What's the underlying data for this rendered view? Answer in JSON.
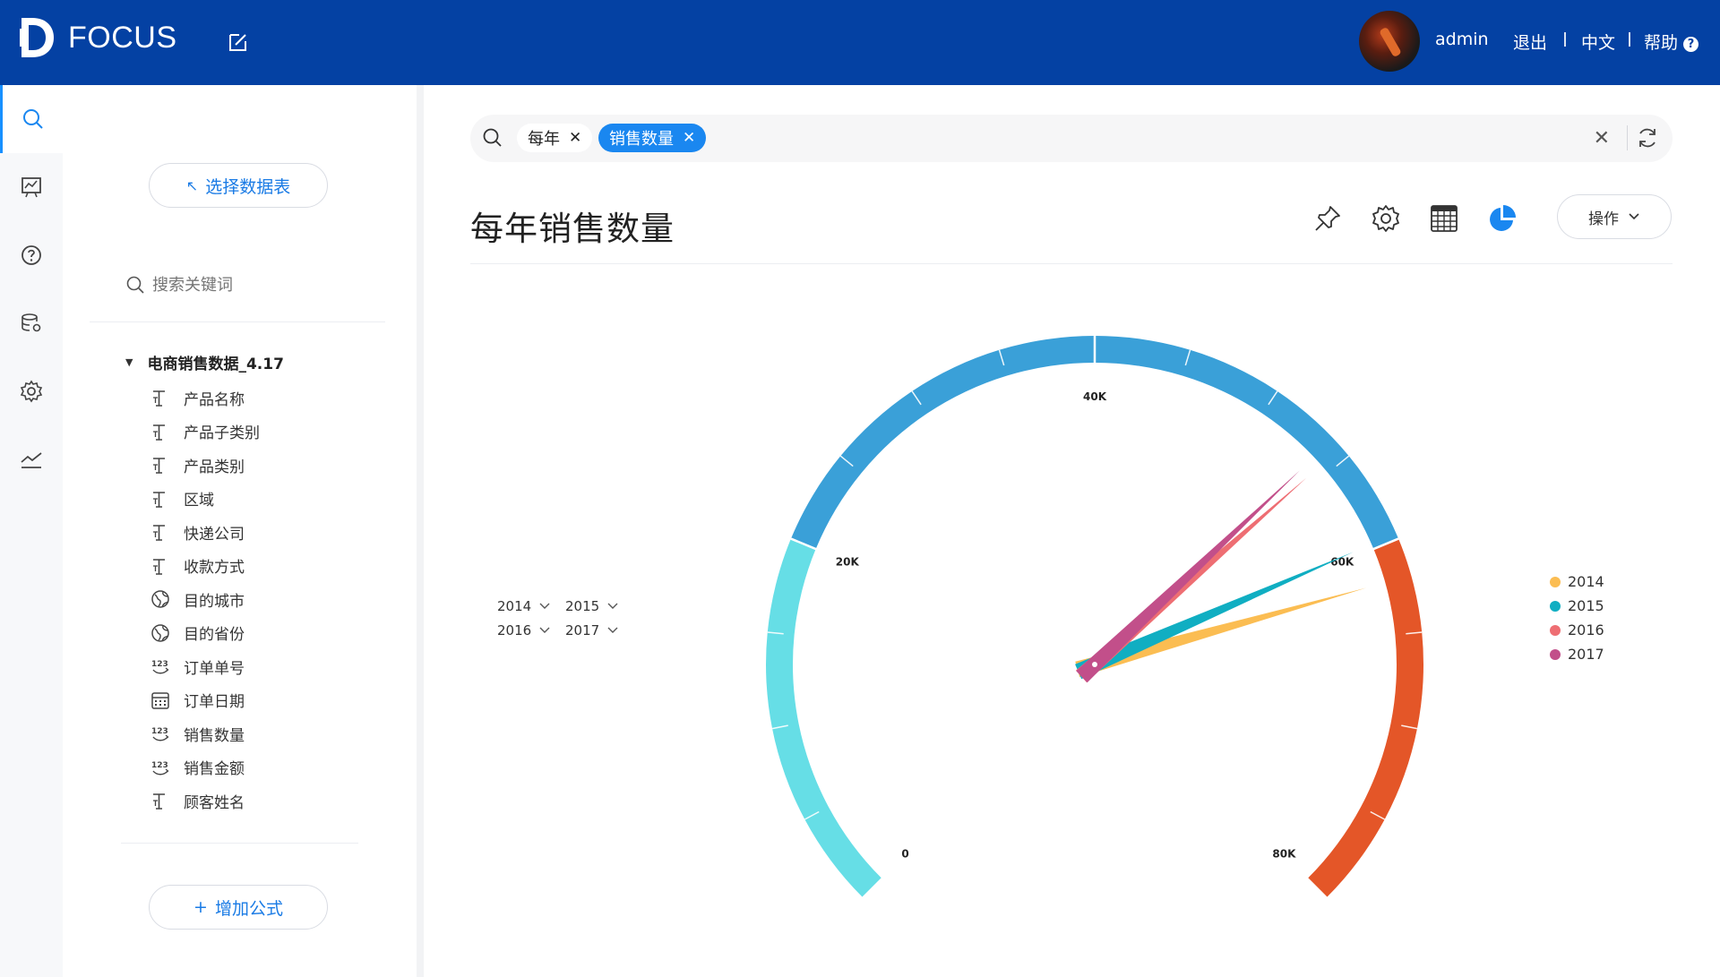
{
  "app": {
    "logo_text": "FOCUS"
  },
  "header": {
    "user": "admin",
    "logout": "退出",
    "language": "中文",
    "help": "帮助"
  },
  "rail": {
    "items": [
      {
        "icon": "search-icon"
      },
      {
        "icon": "dashboard-icon"
      },
      {
        "icon": "help-icon"
      },
      {
        "icon": "database-settings-icon"
      },
      {
        "icon": "gear-icon"
      },
      {
        "icon": "trend-icon"
      }
    ]
  },
  "panel": {
    "select_table": "选择数据表",
    "search_placeholder": "搜索关键词",
    "table_name": "电商销售数据_4.17",
    "fields": [
      {
        "label": "产品名称",
        "icon": "text-field-icon"
      },
      {
        "label": "产品子类别",
        "icon": "text-field-icon"
      },
      {
        "label": "产品类别",
        "icon": "text-field-icon"
      },
      {
        "label": "区域",
        "icon": "text-field-icon"
      },
      {
        "label": "快递公司",
        "icon": "text-field-icon"
      },
      {
        "label": "收款方式",
        "icon": "text-field-icon"
      },
      {
        "label": "目的城市",
        "icon": "globe-icon"
      },
      {
        "label": "目的省份",
        "icon": "globe-icon"
      },
      {
        "label": "订单单号",
        "icon": "number-field-icon"
      },
      {
        "label": "订单日期",
        "icon": "calendar-icon"
      },
      {
        "label": "销售数量",
        "icon": "number-field-icon"
      },
      {
        "label": "销售金额",
        "icon": "number-field-icon"
      },
      {
        "label": "顾客姓名",
        "icon": "text-field-icon"
      }
    ],
    "add_formula": "增加公式"
  },
  "search": {
    "chips": [
      {
        "label": "每年",
        "active": false
      },
      {
        "label": "销售数量",
        "active": true
      }
    ]
  },
  "main": {
    "title": "每年销售数量",
    "ops_label": "操作",
    "year_selectors": [
      "2014",
      "2015",
      "2016",
      "2017"
    ]
  },
  "colors": {
    "header": "#0441a3",
    "accent": "#1a87f0",
    "gauge_low": "#66dee6",
    "gauge_mid": "#3aa0d8",
    "gauge_high": "#e45628"
  },
  "chart_data": {
    "type": "gauge",
    "min": 0,
    "max": 80000,
    "tick_labels": [
      "0",
      "20K",
      "40K",
      "60K",
      "80K"
    ],
    "bands": [
      {
        "from": 0,
        "to": 20000,
        "color": "#66dee6"
      },
      {
        "from": 20000,
        "to": 60000,
        "color": "#3aa0d8"
      },
      {
        "from": 60000,
        "to": 80000,
        "color": "#e45628"
      }
    ],
    "series": [
      {
        "name": "2014",
        "value": 62000,
        "color": "#fbbd52"
      },
      {
        "name": "2015",
        "value": 59700,
        "color": "#10aec2"
      },
      {
        "name": "2016",
        "value": 54400,
        "color": "#ee6e73"
      },
      {
        "name": "2017",
        "value": 53800,
        "color": "#c24f8a"
      }
    ],
    "legend_position": "right"
  }
}
